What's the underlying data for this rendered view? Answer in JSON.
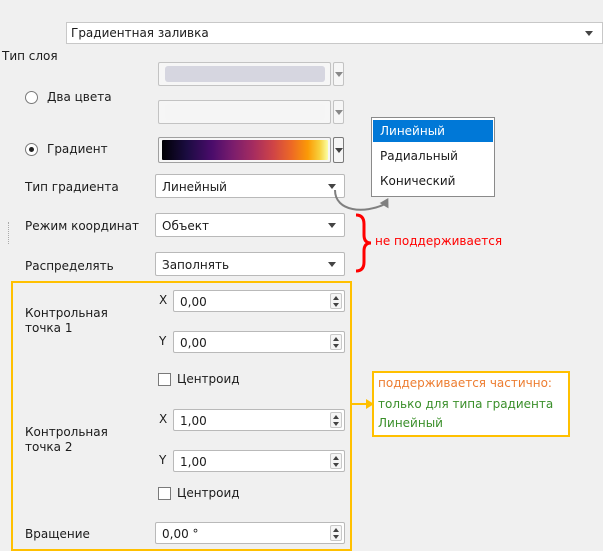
{
  "layer_type": {
    "label": "Тип слоя",
    "value": "Градиентная заливка"
  },
  "fill_mode": {
    "two_colors_label": "Два цвета",
    "gradient_label": "Градиент",
    "selected": "gradient"
  },
  "gradient_type": {
    "label": "Тип градиента",
    "value": "Линейный"
  },
  "gradient_type_popup": {
    "options": [
      "Линейный",
      "Радиальный",
      "Конический"
    ],
    "selected_index": 0
  },
  "coordinate_mode": {
    "label": "Режим координат",
    "value": "Объект"
  },
  "spread": {
    "label": "Распределять",
    "value": "Заполнять"
  },
  "control_point_1": {
    "label": "Контрольная точка 1",
    "x_label": "X",
    "x_value": "0,00",
    "y_label": "Y",
    "y_value": "0,00",
    "centroid_label": "Центроид"
  },
  "control_point_2": {
    "label": "Контрольная точка 2",
    "x_label": "X",
    "x_value": "1,00",
    "y_label": "Y",
    "y_value": "1,00",
    "centroid_label": "Центроид"
  },
  "rotation": {
    "label": "Вращение",
    "value": "0,00 °"
  },
  "annotations": {
    "not_supported": "не поддерживается",
    "partial_line1": "поддерживается частично:",
    "partial_line2": "только для типа градиента",
    "partial_line3": "Линейный"
  },
  "colors": {
    "accent_red": "#ff0000",
    "accent_yellow": "#ffc000",
    "accent_orange": "#ed7d31",
    "accent_green": "#3a8f2a",
    "selection_blue": "#0078d7",
    "arrow_gray": "#808080",
    "color1_swatch": "#d6d6e0",
    "color2_swatch": "#f5f5f5"
  }
}
